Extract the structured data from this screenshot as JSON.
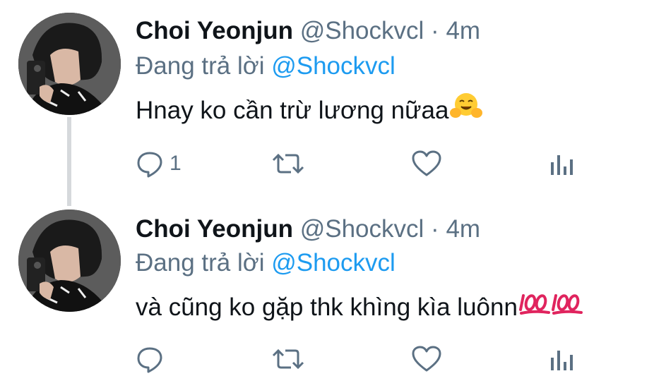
{
  "colors": {
    "accent": "#1d9bf0",
    "muted": "#5b7083",
    "text": "#0f1419",
    "thread_line": "#d6d9dc"
  },
  "tweets": [
    {
      "name": "Choi Yeonjun",
      "handle": "@Shockvcl",
      "separator": "·",
      "time": "4m",
      "reply_prefix": "Đang trả lời",
      "reply_mention": "@Shockvcl",
      "text": "Hnay ko cần trừ lương nữaa",
      "emoji": "hugging-face",
      "reply_count": "1"
    },
    {
      "name": "Choi Yeonjun",
      "handle": "@Shockvcl",
      "separator": "·",
      "time": "4m",
      "reply_prefix": "Đang trả lời",
      "reply_mention": "@Shockvcl",
      "text": "và cũng ko gặp thk khìng kìa luônn",
      "emoji": "hundred-points-x2",
      "reply_count": ""
    }
  ]
}
